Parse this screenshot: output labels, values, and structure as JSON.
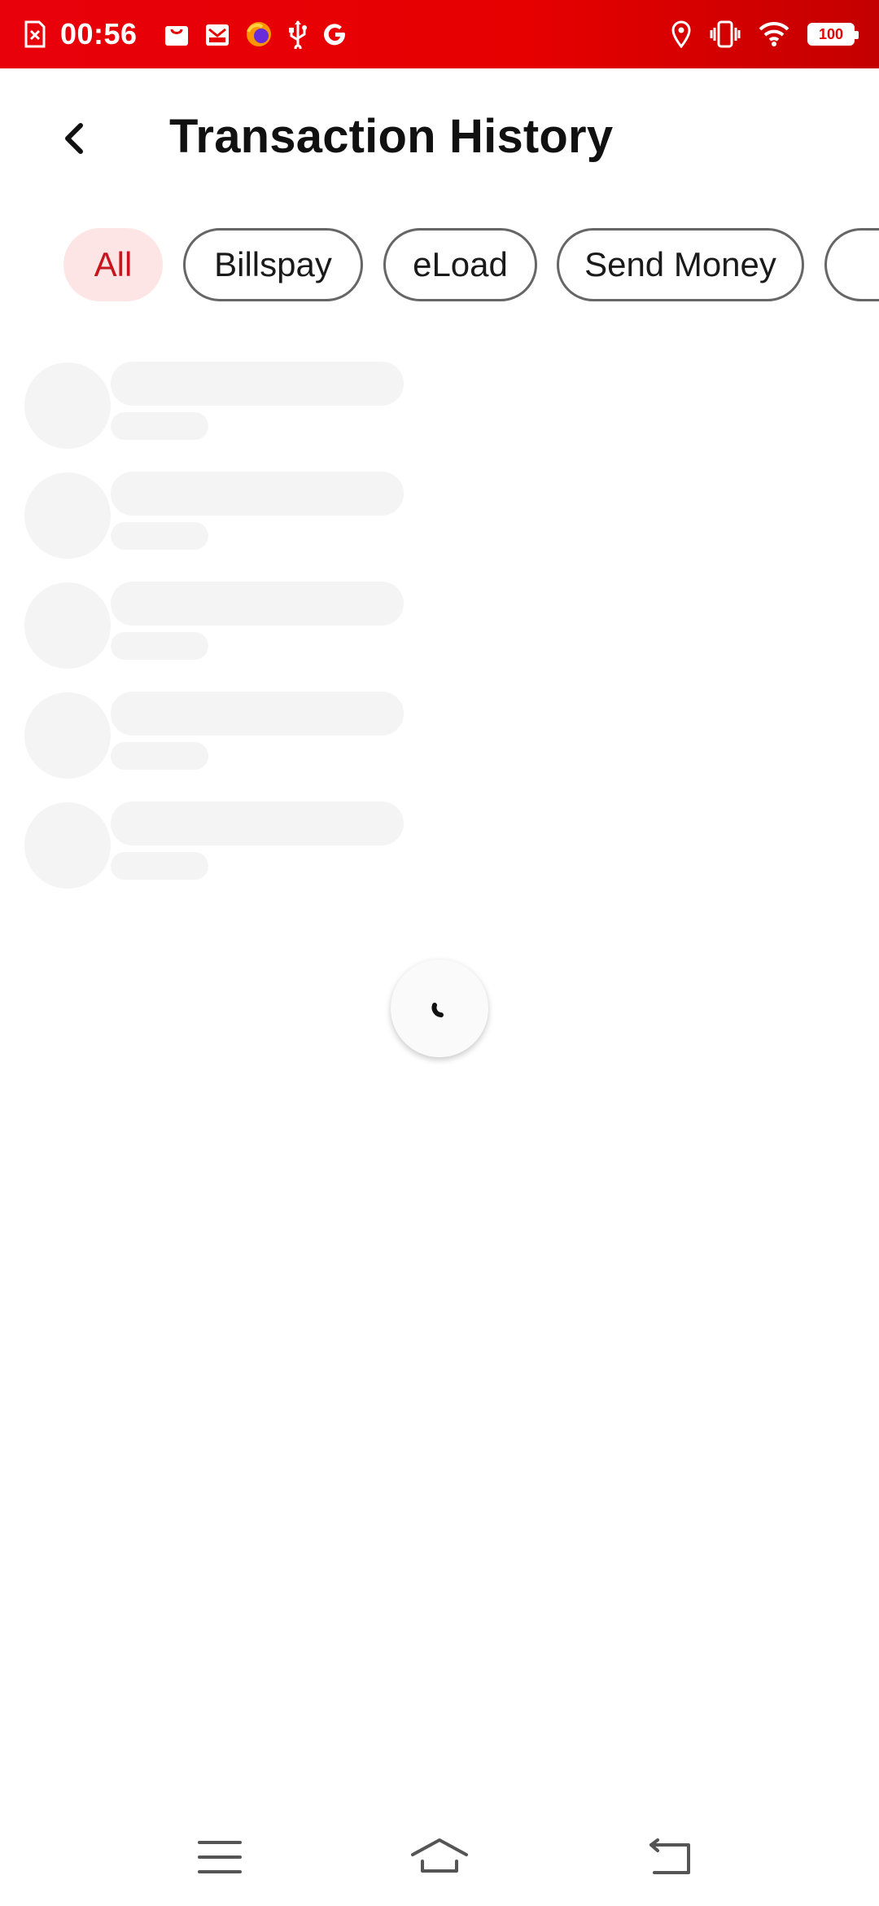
{
  "status_bar": {
    "time": "00:56",
    "battery_level": "100",
    "notification_icons": [
      "sim-error-icon",
      "bag-icon",
      "mail-icon",
      "firefox-icon",
      "usb-icon",
      "google-icon"
    ],
    "system_icons": [
      "location-icon",
      "vibrate-icon",
      "wifi-icon",
      "battery-icon"
    ],
    "background_color": "#e60000"
  },
  "header": {
    "title": "Transaction History",
    "back_icon": "chevron-left-icon"
  },
  "filters": {
    "chips": [
      {
        "label": "All",
        "active": true
      },
      {
        "label": "Billspay",
        "active": false
      },
      {
        "label": "eLoad",
        "active": false
      },
      {
        "label": "Send Money",
        "active": false
      },
      {
        "label": "",
        "active": false
      }
    ],
    "active_color": "#c8141c",
    "active_background": "#fde5e5"
  },
  "list": {
    "state": "loading",
    "skeleton_rows": 5
  },
  "nav_bar": {
    "buttons": [
      "menu-icon",
      "home-icon",
      "back-icon"
    ]
  }
}
